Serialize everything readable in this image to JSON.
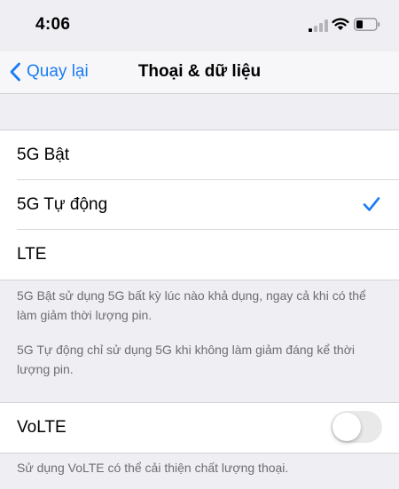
{
  "status_bar": {
    "time": "4:06",
    "icons": [
      "signal-icon",
      "wifi-icon",
      "battery-icon"
    ]
  },
  "nav": {
    "back_label": "Quay lại",
    "title": "Thoại & dữ liệu"
  },
  "options": [
    {
      "label": "5G Bật",
      "selected": false
    },
    {
      "label": "5G Tự động",
      "selected": true
    },
    {
      "label": "LTE",
      "selected": false
    }
  ],
  "footer_notes": [
    "5G Bật sử dụng 5G bất kỳ lúc nào khả dụng, ngay cả khi có thể làm giảm thời lượng pin.",
    "5G Tự động chỉ sử dụng 5G khi không làm giảm đáng kể thời lượng pin."
  ],
  "volte": {
    "label": "VoLTE",
    "enabled": false,
    "footer": "Sử dụng VoLTE có thể cải thiện chất lượng thoại."
  },
  "colors": {
    "accent": "#1a7cf2",
    "background": "#efeef3",
    "secondary_text": "#6d6d72"
  }
}
